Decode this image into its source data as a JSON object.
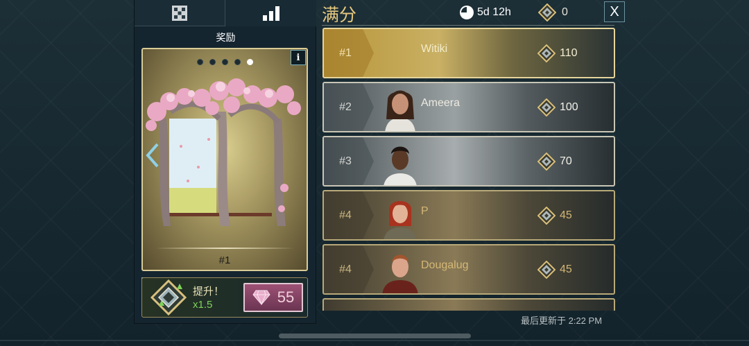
{
  "tabs": [
    {
      "name": "grid",
      "icon": "grid-icon"
    },
    {
      "name": "leaderboard",
      "icon": "bar-chart-icon"
    }
  ],
  "rewards": {
    "title": "奖励",
    "rank_label": "#1",
    "info_label": "i",
    "dots_total": 5,
    "dots_active": 5,
    "boost_text": "提升！",
    "boost_multiplier": "x1.5",
    "gem_value": "55"
  },
  "header": {
    "title": "满分",
    "timer": "5d 12h",
    "points": "0",
    "close_label": "X"
  },
  "leaderboard": [
    {
      "rank": "#1",
      "name": "Witiki",
      "score": "110",
      "style": "r1",
      "avatar": "none"
    },
    {
      "rank": "#2",
      "name": "Ameera",
      "score": "100",
      "style": "r2",
      "avatar": "woman-brown-hair"
    },
    {
      "rank": "#3",
      "name": "",
      "score": "70",
      "style": "r3",
      "avatar": "man-dark-skin"
    },
    {
      "rank": "#4",
      "name": "P",
      "score": "45",
      "style": "r4",
      "avatar": "woman-red-hair"
    },
    {
      "rank": "#4",
      "name": "Dougalug",
      "score": "45",
      "style": "r4",
      "avatar": "man-ginger-hair"
    }
  ],
  "footer": {
    "updated": "最后更新于 2:22 PM"
  },
  "colors": {
    "gold": "#e6c97f",
    "boost_green": "#7ed35a",
    "gem_pink": "#9d5175"
  }
}
